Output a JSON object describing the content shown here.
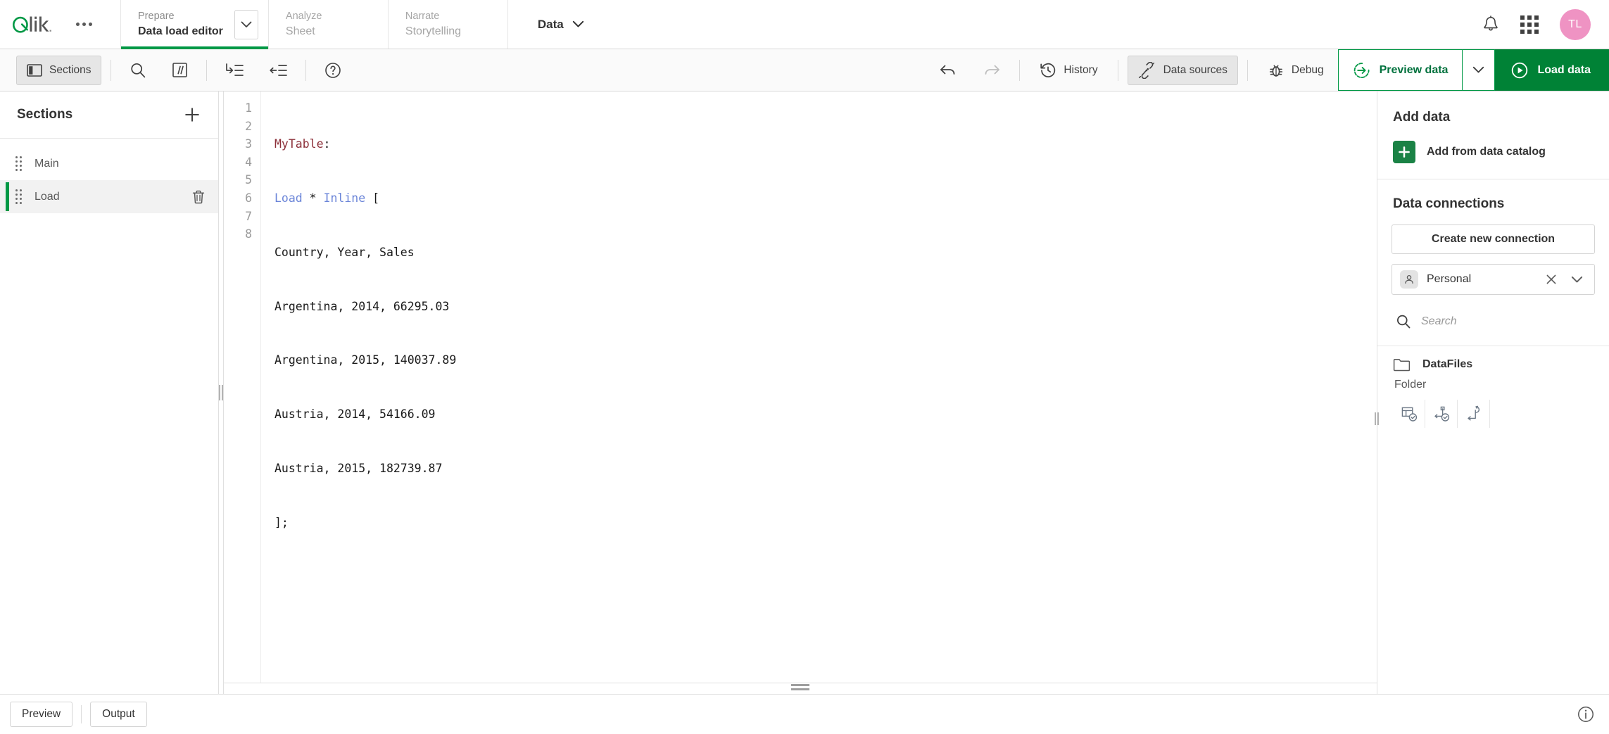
{
  "header": {
    "logo_alt": "Qlik",
    "more_menu": "more-menu",
    "nav": [
      {
        "top": "Prepare",
        "bottom": "Data load editor",
        "active": true
      },
      {
        "top": "Analyze",
        "bottom": "Sheet",
        "active": false
      },
      {
        "top": "Narrate",
        "bottom": "Storytelling",
        "active": false
      }
    ],
    "data_menu_label": "Data",
    "avatar_initials": "TL"
  },
  "toolbar": {
    "sections_label": "Sections",
    "search_label": "search",
    "comment_label": "//",
    "indent_label": "indent",
    "outdent_label": "outdent",
    "help_label": "help",
    "undo_label": "undo",
    "redo_label": "redo",
    "history_label": "History",
    "data_sources_label": "Data sources",
    "debug_label": "Debug",
    "preview_data_label": "Preview data",
    "load_data_label": "Load data"
  },
  "sections": {
    "title": "Sections",
    "add_label": "+",
    "items": [
      {
        "name": "Main",
        "selected": false
      },
      {
        "name": "Load",
        "selected": true
      }
    ]
  },
  "editor": {
    "line_numbers": [
      "1",
      "2",
      "3",
      "4",
      "5",
      "6",
      "7",
      "8"
    ],
    "lines": [
      {
        "tokens": [
          {
            "t": "MyTable",
            "c": "tok-table"
          },
          {
            "t": ":",
            "c": "tok-plain"
          }
        ]
      },
      {
        "tokens": [
          {
            "t": "Load",
            "c": "tok-kw"
          },
          {
            "t": " * ",
            "c": "tok-plain"
          },
          {
            "t": "Inline",
            "c": "tok-kw"
          },
          {
            "t": " [",
            "c": "tok-plain"
          }
        ]
      },
      {
        "tokens": [
          {
            "t": "Country, Year, Sales",
            "c": "tok-plain"
          }
        ]
      },
      {
        "tokens": [
          {
            "t": "Argentina, 2014, 66295.03",
            "c": "tok-plain"
          }
        ]
      },
      {
        "tokens": [
          {
            "t": "Argentina, 2015, 140037.89",
            "c": "tok-plain"
          }
        ]
      },
      {
        "tokens": [
          {
            "t": "Austria, 2014, 54166.09",
            "c": "tok-plain"
          }
        ]
      },
      {
        "tokens": [
          {
            "t": "Austria, 2015, 182739.87",
            "c": "tok-plain"
          }
        ]
      },
      {
        "tokens": [
          {
            "t": "];",
            "c": "tok-plain"
          }
        ]
      }
    ]
  },
  "data_panel": {
    "add_data_title": "Add data",
    "add_from_catalog": "Add from data catalog",
    "data_connections_title": "Data connections",
    "create_new_connection": "Create new connection",
    "space_value": "Personal",
    "search_placeholder": "Search",
    "connections": [
      {
        "name": "DataFiles",
        "type": "Folder"
      }
    ]
  },
  "footer": {
    "preview_label": "Preview",
    "output_label": "Output",
    "info_label": "info"
  },
  "colors": {
    "brand_green": "#009845",
    "load_button_green": "#008236",
    "catalog_tile_green": "#1a8245",
    "avatar_pink": "#ef93c3",
    "selected_row": "#f2f2f2",
    "toolbar_bg": "#fafafa",
    "code_table": "#8c2f39",
    "code_keyword": "#6a84d8"
  }
}
